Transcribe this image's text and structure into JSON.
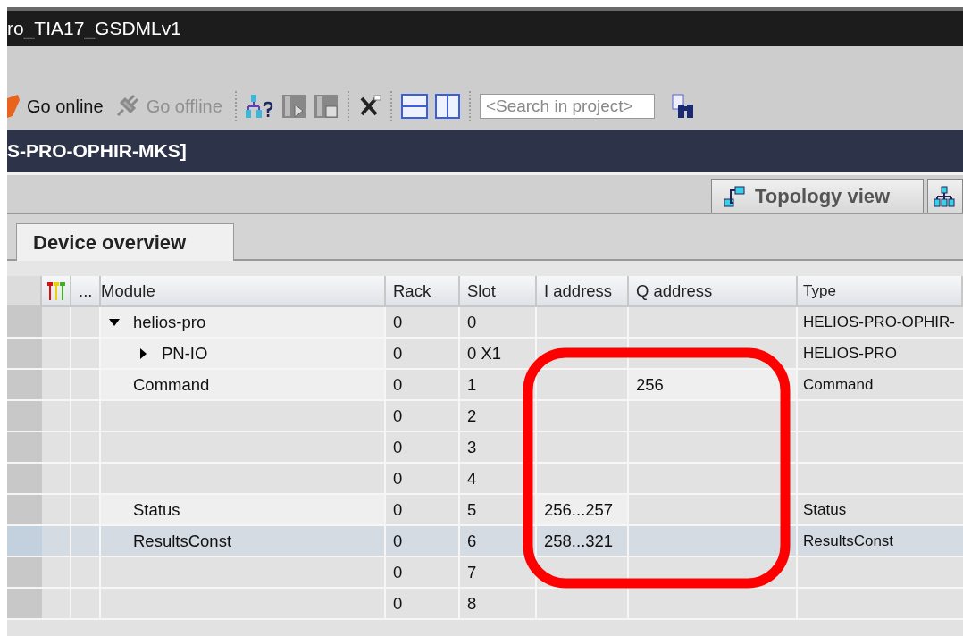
{
  "window": {
    "title": "ro_TIA17_GSDMLv1"
  },
  "toolbar": {
    "buttons": [
      {
        "label": "Go online",
        "disabled": false
      },
      {
        "label": "Go offline",
        "disabled": true
      }
    ],
    "search": {
      "placeholder": "<Search in project>"
    }
  },
  "editor": {
    "title": "S-PRO-OPHIR-MKS]",
    "view_buttons": [
      {
        "label": "Topology view"
      }
    ],
    "tabs": [
      {
        "label": "Device overview",
        "selected": true
      }
    ]
  },
  "table": {
    "columns": [
      "...",
      "Module",
      "Rack",
      "Slot",
      "I address",
      "Q address",
      "Type"
    ],
    "rows": [
      {
        "module": "helios-pro",
        "rack": "0",
        "slot": "0",
        "type": "HELIOS-PRO-OPHIR-",
        "selected": false,
        "expanded": true,
        "children": [
          {
            "module": "PN-IO",
            "rack": "0",
            "slot": "0 X1",
            "type": "HELIOS-PRO",
            "selected": false,
            "expanded": false
          }
        ]
      },
      {
        "module": "Command",
        "rack": "0",
        "slot": "1",
        "q_address": "256",
        "type": "Command",
        "selected": false
      },
      {
        "rack": "0",
        "slot": "2",
        "selected": false
      },
      {
        "rack": "0",
        "slot": "3",
        "selected": false
      },
      {
        "rack": "0",
        "slot": "4",
        "selected": false
      },
      {
        "module": "Status",
        "rack": "0",
        "slot": "5",
        "i_address": "256...257",
        "type": "Status",
        "selected": false
      },
      {
        "module": "ResultsConst",
        "rack": "0",
        "slot": "6",
        "i_address": "258...321",
        "type": "ResultsConst",
        "selected": true
      },
      {
        "rack": "0",
        "slot": "7",
        "selected": false
      },
      {
        "rack": "0",
        "slot": "8",
        "selected": false
      }
    ]
  }
}
